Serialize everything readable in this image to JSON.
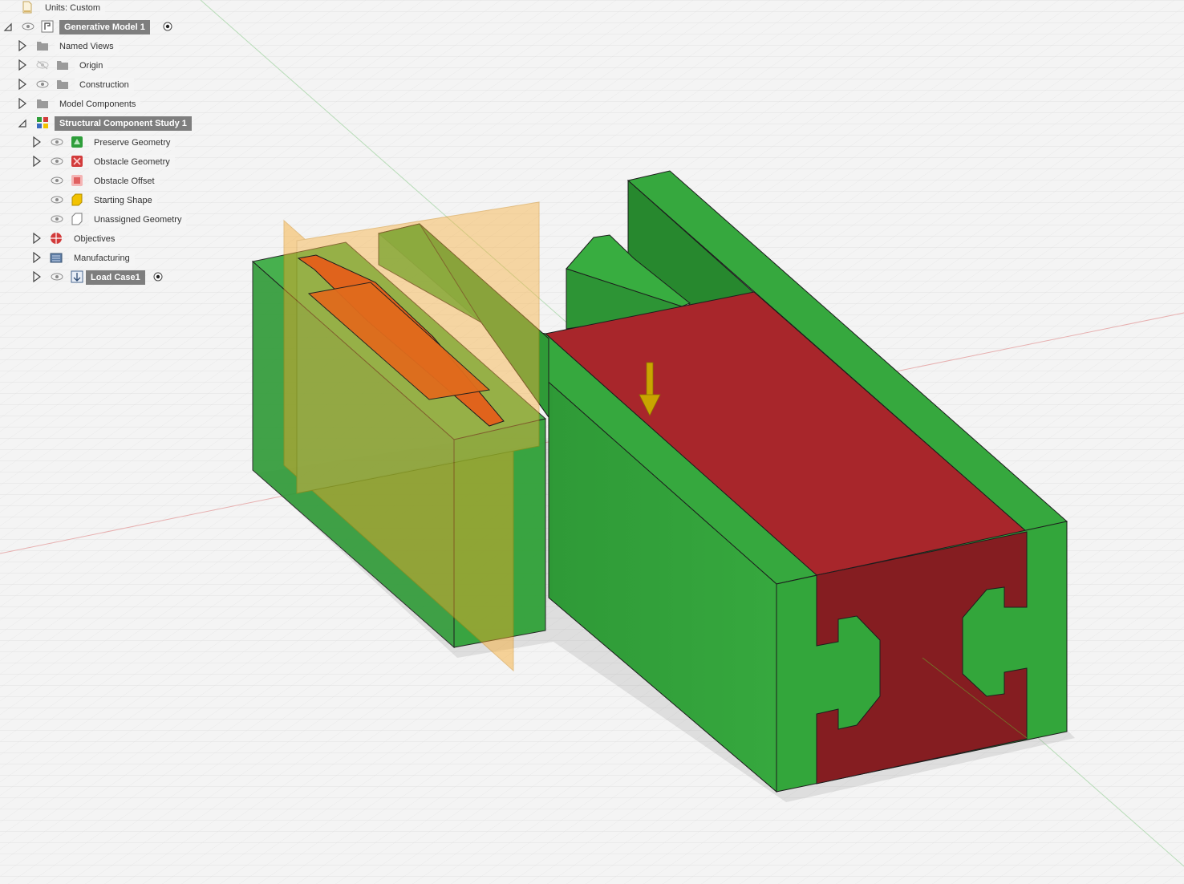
{
  "browser": {
    "units_label": "Units: Custom",
    "root": {
      "label": "Generative Model 1",
      "icon": "component-icon"
    },
    "named_views": {
      "label": "Named Views",
      "icon": "folder-icon"
    },
    "origin": {
      "label": "Origin",
      "icon": "folder-icon",
      "visible": false
    },
    "construction": {
      "label": "Construction",
      "icon": "folder-icon"
    },
    "model_components": {
      "label": "Model Components",
      "icon": "folder-icon"
    },
    "study": {
      "label": "Structural Component Study 1",
      "icon": "study-icon"
    },
    "preserve": {
      "label": "Preserve Geometry",
      "icon": "preserve-geometry-icon",
      "color": "#2e9e3a"
    },
    "obstacle": {
      "label": "Obstacle Geometry",
      "icon": "obstacle-geometry-icon",
      "color": "#d23b3b"
    },
    "obstacle_offset": {
      "label": "Obstacle Offset",
      "icon": "obstacle-offset-icon",
      "color": "#e06060"
    },
    "starting_shape": {
      "label": "Starting Shape",
      "icon": "starting-shape-icon",
      "color": "#f2c200"
    },
    "unassigned": {
      "label": "Unassigned Geometry",
      "icon": "unassigned-geometry-icon"
    },
    "objectives": {
      "label": "Objectives",
      "icon": "objectives-icon",
      "color": "#d23b3b"
    },
    "manufacturing": {
      "label": "Manufacturing",
      "icon": "manufacturing-icon"
    },
    "load_case": {
      "label": "Load Case1",
      "icon": "load-case-icon"
    }
  },
  "viewport": {
    "preserve_color": "#33a63b",
    "obstacle_color": "#a8262b",
    "starting_shape_color": "#f7a728",
    "load_arrow_color": "#c9a400"
  }
}
